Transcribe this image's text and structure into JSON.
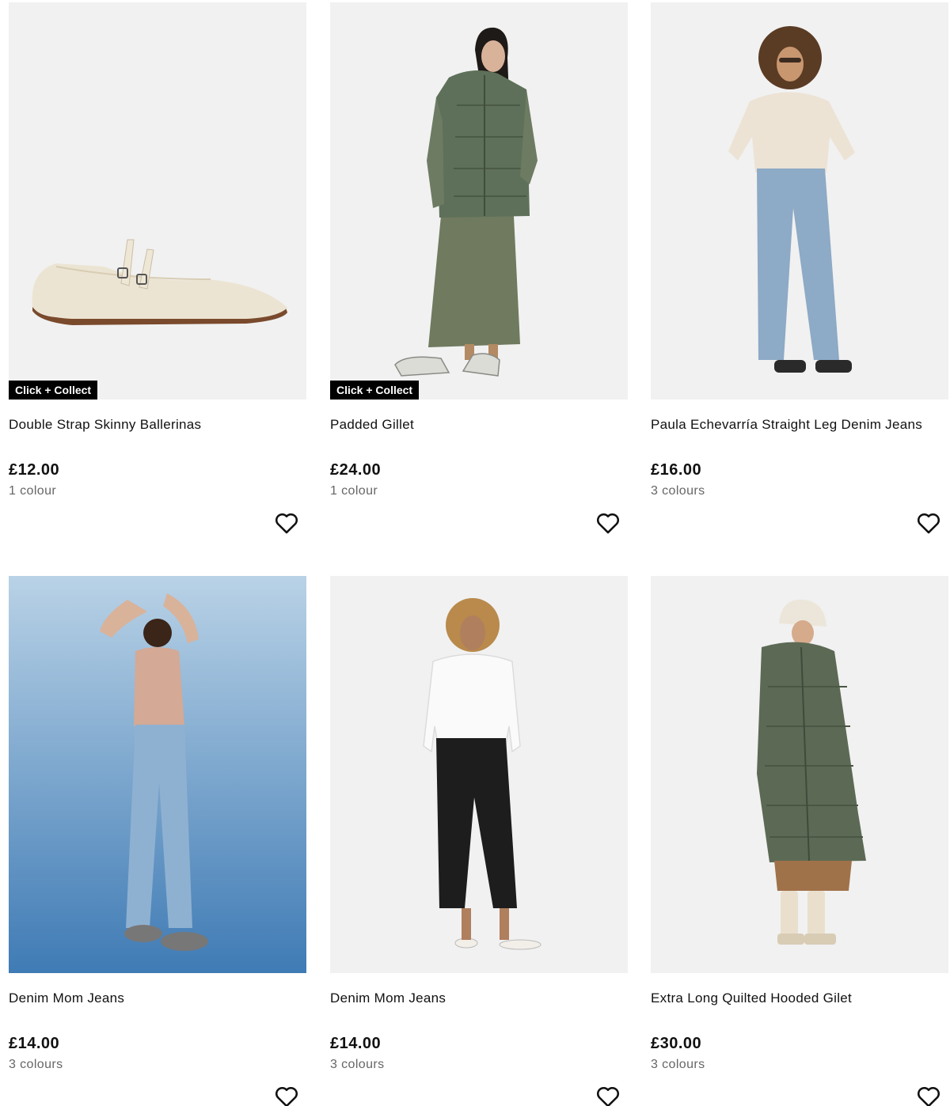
{
  "products": [
    {
      "name": "Double Strap Skinny Ballerinas",
      "price": "£12.00",
      "colours": "1 colour",
      "badge": "Click + Collect",
      "image": "cream-double-strap-ballerina-flat",
      "favourite_icon": "heart-outline-icon"
    },
    {
      "name": "Padded Gillet",
      "price": "£24.00",
      "colours": "1 colour",
      "badge": "Click + Collect",
      "image": "model-green-padded-gilet-khaki-maxi-skirt",
      "favourite_icon": "heart-outline-icon"
    },
    {
      "name": "Paula Echevarría Straight Leg Denim Jeans",
      "price": "£16.00",
      "colours": "3 colours",
      "badge": "",
      "image": "model-cream-v-neck-jumper-light-blue-straight-jeans",
      "favourite_icon": "heart-outline-icon"
    },
    {
      "name": "Denim Mom Jeans",
      "price": "£14.00",
      "colours": "3 colours",
      "badge": "",
      "image": "model-beige-top-light-blue-mom-jeans-blue-backdrop",
      "favourite_icon": "heart-outline-icon"
    },
    {
      "name": "Denim Mom Jeans",
      "price": "£14.00",
      "colours": "3 colours",
      "badge": "",
      "image": "model-white-shirt-black-mom-jeans",
      "favourite_icon": "heart-outline-icon"
    },
    {
      "name": "Extra Long Quilted Hooded Gilet",
      "price": "£30.00",
      "colours": "3 colours",
      "badge": "",
      "image": "model-long-khaki-hooded-gilet-bucket-hat",
      "favourite_icon": "heart-outline-icon"
    }
  ],
  "colors": {
    "badge_bg": "#000000",
    "badge_text": "#ffffff",
    "price": "#111111",
    "colours_text": "#666666",
    "image_bg": "#f1f1f1"
  }
}
